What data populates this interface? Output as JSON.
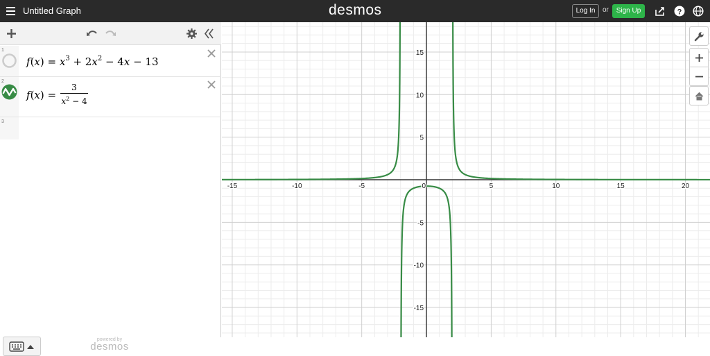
{
  "header": {
    "title": "Untitled Graph",
    "logo": "desmos",
    "login_label": "Log In",
    "or_text": "or",
    "signup_label": "Sign Up",
    "icons": [
      "menu-icon",
      "share-icon",
      "help-icon",
      "globe-icon"
    ]
  },
  "toolbar": {
    "icons": [
      "add-icon",
      "undo-icon",
      "redo-icon",
      "settings-icon",
      "collapse-icon"
    ]
  },
  "expressions": [
    {
      "index": "1",
      "color": "#cccccc",
      "lhs": "f",
      "arg": "x"
    },
    {
      "index": "2",
      "color": "#388c46",
      "lhs": "f",
      "arg": "x",
      "numerator": "3"
    },
    {
      "index": "3"
    }
  ],
  "footer": {
    "powered_by": "powered by",
    "brand": "desmos"
  },
  "graph_controls": {
    "icons": [
      "wrench-icon",
      "zoom-in-icon",
      "zoom-out-icon",
      "home-icon"
    ]
  },
  "chart_data": {
    "type": "line",
    "xlim": [
      -15.8,
      21.9
    ],
    "ylim": [
      -18.5,
      18.5
    ],
    "x_ticks": [
      -15,
      -10,
      -5,
      0,
      5,
      10,
      15,
      20
    ],
    "y_ticks": [
      -15,
      -10,
      -5,
      5,
      10,
      15
    ],
    "minor_step": 1,
    "grid": true,
    "series": [
      {
        "color": "#388c46",
        "function": "3/(x^2-4)",
        "asymptotes": [
          -2,
          2
        ]
      }
    ]
  }
}
